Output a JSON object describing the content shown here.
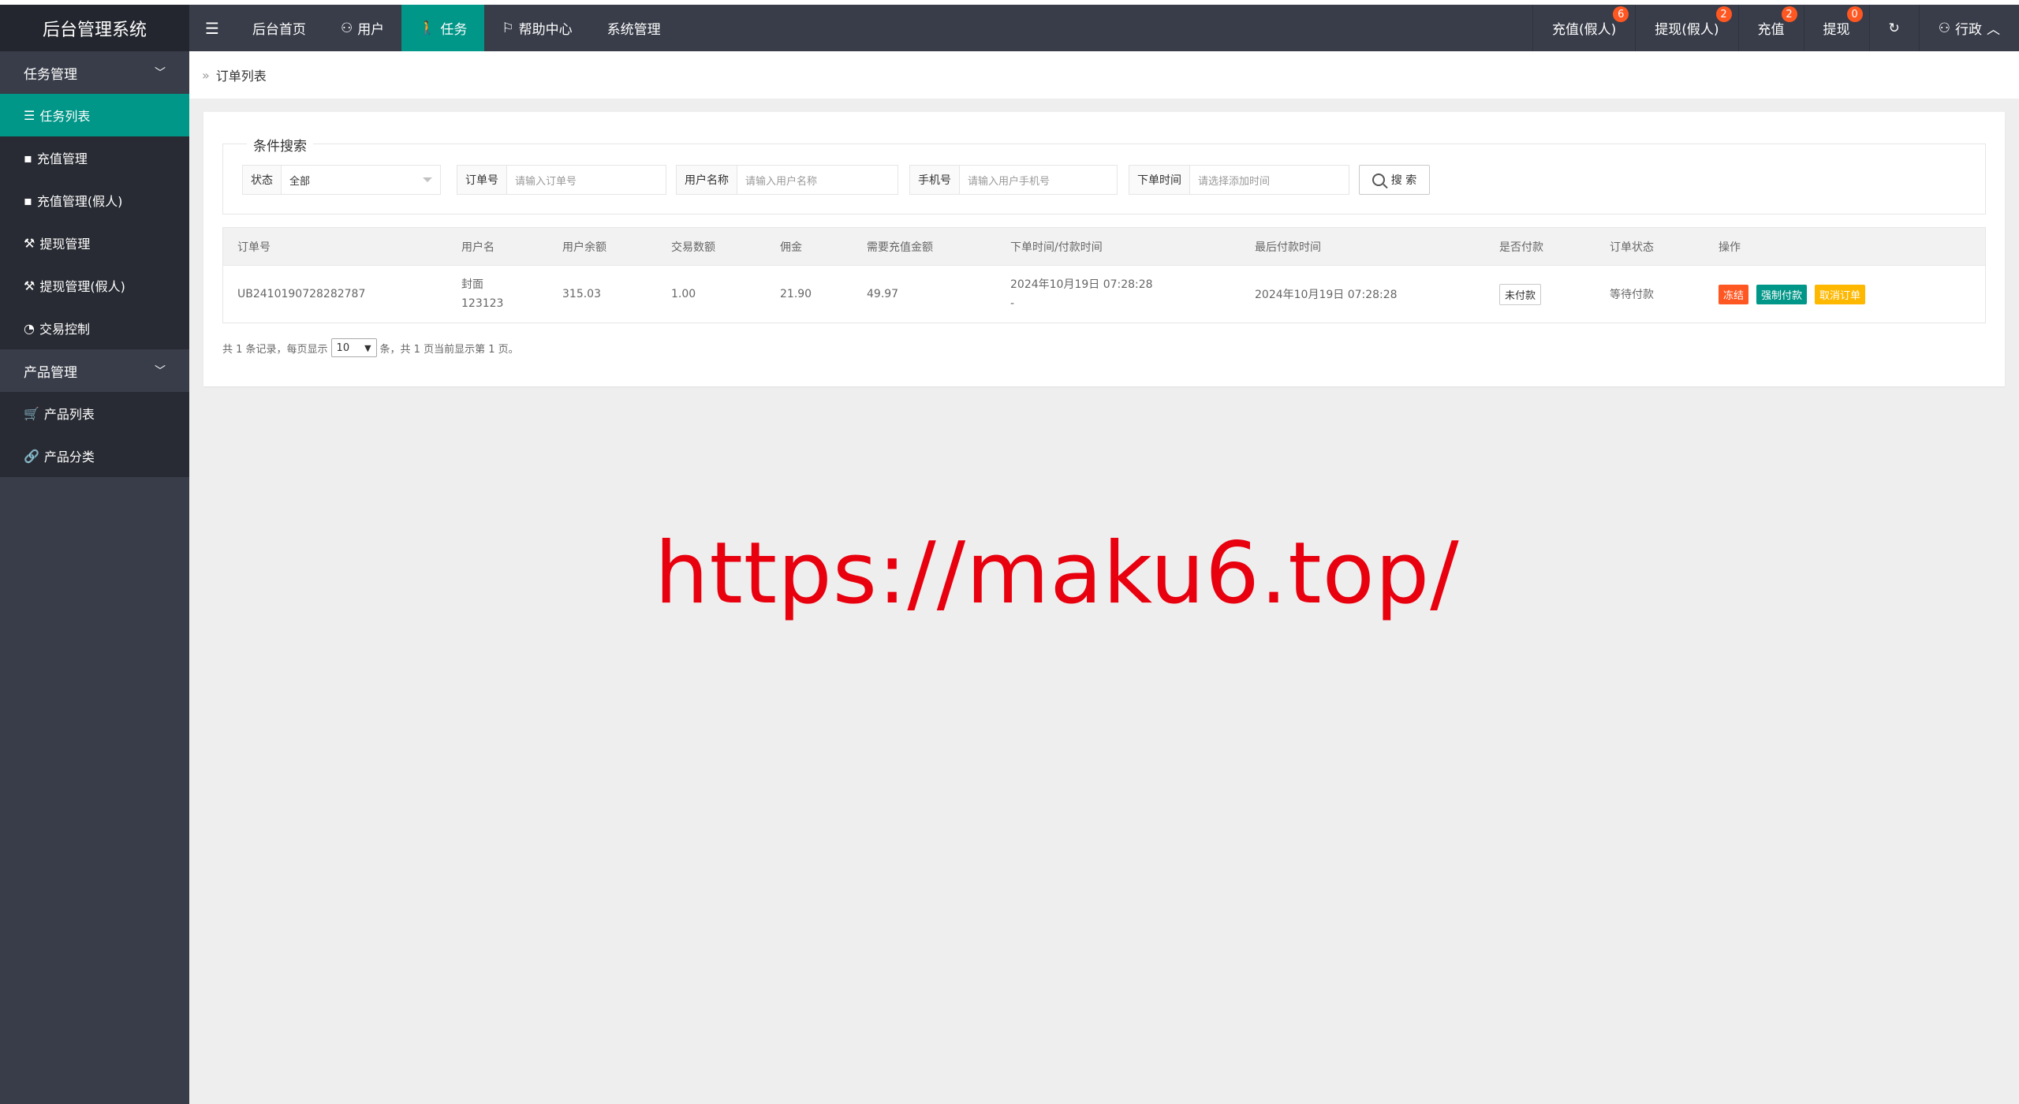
{
  "header": {
    "logo": "后台管理系统",
    "nav": [
      {
        "label": "后台首页",
        "icon": ""
      },
      {
        "label": "用户",
        "icon": "user-icon"
      },
      {
        "label": "任务",
        "icon": "walk-icon"
      },
      {
        "label": "帮助中心",
        "icon": "flag-icon"
      },
      {
        "label": "系统管理",
        "icon": ""
      }
    ],
    "right": [
      {
        "label": "充值(假人)",
        "badge": "6"
      },
      {
        "label": "提现(假人)",
        "badge": "2"
      },
      {
        "label": "充值",
        "badge": "2"
      },
      {
        "label": "提现",
        "badge": "0"
      }
    ],
    "user": "行政"
  },
  "sidebar": {
    "group1": "任务管理",
    "group1_items": [
      "任务列表",
      "充值管理",
      "充值管理(假人)",
      "提现管理",
      "提现管理(假人)",
      "交易控制"
    ],
    "group2": "产品管理",
    "group2_items": [
      "产品列表",
      "产品分类"
    ]
  },
  "breadcrumb": {
    "sep": "»",
    "current": "订单列表"
  },
  "search": {
    "legend": "条件搜索",
    "status_label": "状态",
    "status_value": "全部",
    "order_label": "订单号",
    "order_placeholder": "请输入订单号",
    "username_label": "用户名称",
    "username_placeholder": "请输入用户名称",
    "phone_label": "手机号",
    "phone_placeholder": "请输入用户手机号",
    "time_label": "下单时间",
    "time_placeholder": "请选择添加时间",
    "button": "搜 索"
  },
  "table": {
    "headers": [
      "订单号",
      "用户名",
      "用户余额",
      "交易数额",
      "佣金",
      "需要充值金额",
      "下单时间/付款时间",
      "最后付款时间",
      "是否付款",
      "订单状态",
      "操作"
    ],
    "rows": [
      {
        "order_no": "UB2410190728282787",
        "username_line1": "封面",
        "username_line2": "123123",
        "balance": "315.03",
        "amount": "1.00",
        "commission": "21.90",
        "recharge_needed": "49.97",
        "order_time": "2024年10月19日 07:28:28",
        "pay_time": "-",
        "last_pay_time": "2024年10月19日 07:28:28",
        "paid": "未付款",
        "status": "等待付款",
        "actions": [
          "冻结",
          "强制付款",
          "取消订单"
        ]
      }
    ]
  },
  "pager": {
    "prefix": "共 1 条记录，每页显示",
    "page_size": "10",
    "suffix": "条，共 1 页当前显示第 1 页。"
  },
  "watermark": "https://maku6.top/"
}
